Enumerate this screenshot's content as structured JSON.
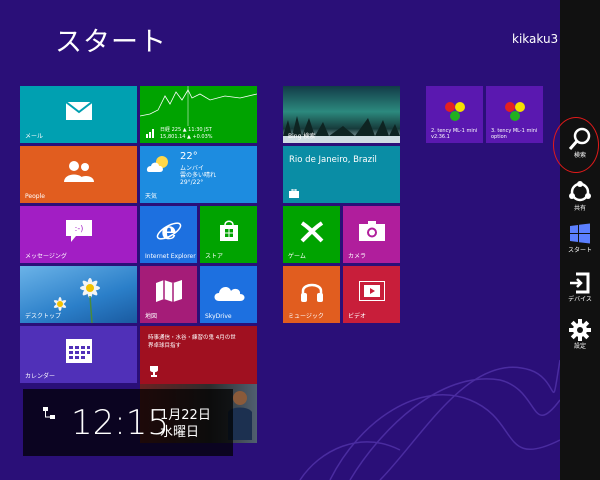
{
  "screen": {
    "title": "スタート",
    "user": "kikaku3"
  },
  "tiles": {
    "mail": {
      "label": "メール"
    },
    "finance": {
      "line1": "日経 225 ▲ 11:30 JST",
      "line2": "15,801.14 ▲ +0.03%"
    },
    "bing": {
      "label": "Bing 検索"
    },
    "app1": {
      "label": "2. tency ML-1 mini v2.36.1"
    },
    "app2": {
      "label": "3. tency ML-1 mini option"
    },
    "people": {
      "label": "People"
    },
    "weather": {
      "temp": "22°",
      "city": "ムンバイ",
      "desc": "雲の多い晴れ",
      "range": "29°/22°",
      "label": "天気"
    },
    "travel": {
      "place": "Rio de Janeiro, Brazil"
    },
    "messaging": {
      "label": "メッセージング"
    },
    "ie": {
      "label": "Internet Explorer"
    },
    "store": {
      "label": "ストア"
    },
    "games": {
      "label": "ゲーム"
    },
    "camera": {
      "label": "カメラ"
    },
    "desktop": {
      "label": "デスクトップ"
    },
    "maps": {
      "label": "地図"
    },
    "skydrive": {
      "label": "SkyDrive"
    },
    "music": {
      "label": "ミュージック"
    },
    "video": {
      "label": "ビデオ"
    },
    "calendar": {
      "label": "カレンダー"
    },
    "news": {
      "text": "時事通信・水谷・練習の鬼 4月の世界卓球目指す"
    }
  },
  "clock": {
    "time": "12:15",
    "date": "1月22日",
    "day": "水曜日"
  },
  "charms": [
    {
      "label": "検索"
    },
    {
      "label": "共有"
    },
    {
      "label": "スタート"
    },
    {
      "label": "デバイス"
    },
    {
      "label": "設定"
    }
  ],
  "colors": {
    "background": "#2a0f78",
    "charm_bar": "#111111",
    "highlight_circle": "#e01a1a"
  }
}
